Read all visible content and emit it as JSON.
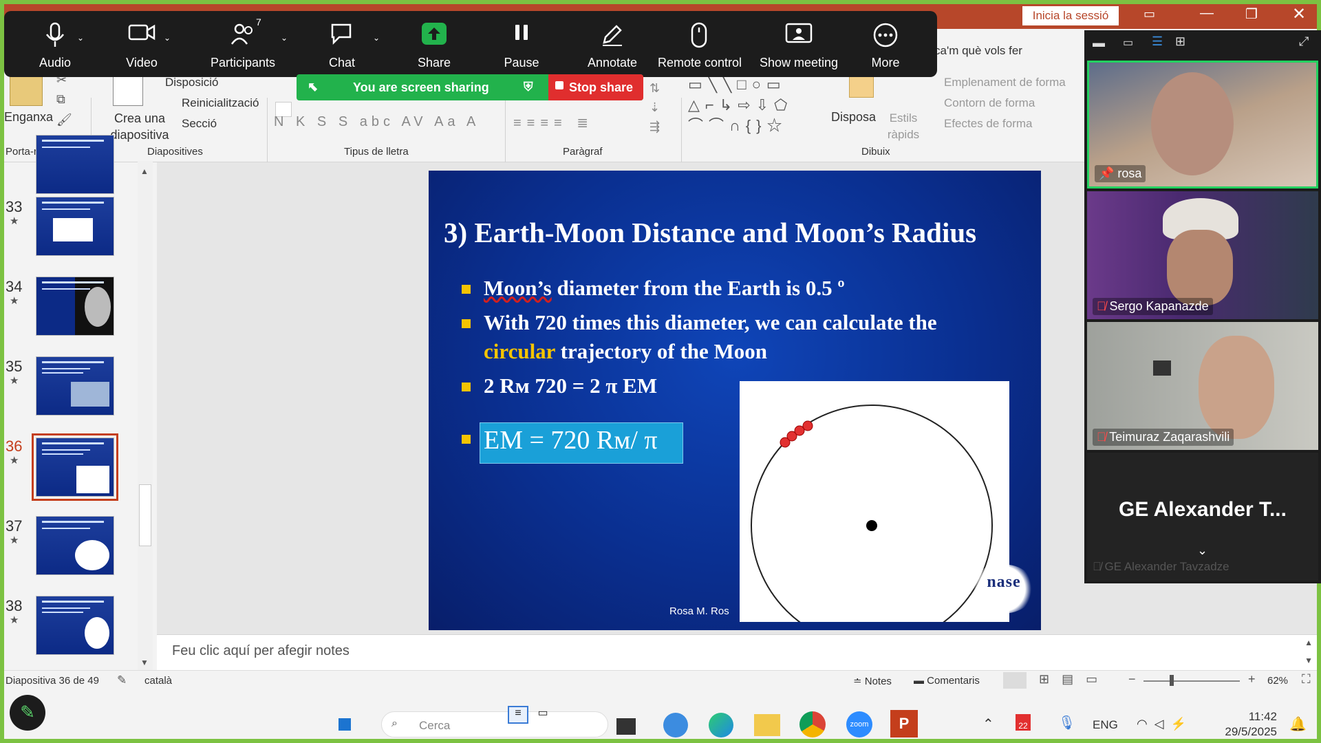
{
  "zoom": {
    "controls": [
      {
        "label": "Audio",
        "icon": "microphone-icon"
      },
      {
        "label": "Video",
        "icon": "video-camera-icon"
      },
      {
        "label": "Participants",
        "icon": "participants-icon",
        "badge": "7"
      },
      {
        "label": "Chat",
        "icon": "chat-icon"
      },
      {
        "label": "Share",
        "icon": "share-screen-icon"
      },
      {
        "label": "Pause",
        "icon": "pause-icon"
      },
      {
        "label": "Annotate",
        "icon": "pencil-icon"
      },
      {
        "label": "Remote control",
        "icon": "mouse-icon"
      },
      {
        "label": "Show meeting",
        "icon": "image-icon"
      },
      {
        "label": "More",
        "icon": "more-icon"
      }
    ],
    "sharing_label": "You are screen sharing",
    "stop_share_label": "Stop share",
    "participants": [
      {
        "name": "rosa",
        "pinned": true
      },
      {
        "name": "Sergo Kapanazde",
        "muted": true
      },
      {
        "name": "Teimuraz Zaqarashvili",
        "muted": true
      },
      {
        "name": "GE Alexander T...",
        "subname": "GE Alexander Tavzadze",
        "muted": true
      }
    ],
    "accent_green": "#22b24c",
    "stop_red": "#e02e2e"
  },
  "titlebar": {
    "signin_label": "Inicia la sessió",
    "tell_me": "ca'm què vols fer"
  },
  "ribbon": {
    "paste_label": "Enganxa",
    "new_slide_label": "Crea una diapositiva",
    "layout_label": "Disposició",
    "reset_label": "Reinicialització",
    "section_label": "Secció",
    "arrange_label": "Disposa",
    "quick_styles_label": "Estils ràpids",
    "shape_fill_label": "Emplenament de forma",
    "shape_outline_label": "Contorn de forma",
    "shape_effects_label": "Efectes de forma",
    "groups": {
      "clipboard": "Porta-retalls",
      "slides": "Diapositives",
      "font": "Tipus de lletra",
      "paragraph": "Paràgraf",
      "drawing": "Dibuix"
    },
    "font_buttons": [
      "N",
      "K",
      "S",
      "S",
      "abc",
      "AV",
      "Aa",
      "A"
    ]
  },
  "thumbnails": [
    {
      "num": "33"
    },
    {
      "num": "34"
    },
    {
      "num": "35"
    },
    {
      "num": "36",
      "selected": true
    },
    {
      "num": "37"
    },
    {
      "num": "38"
    }
  ],
  "slide": {
    "title": "3) Earth-Moon Distance and Moon’s Radius",
    "bullet1_a": "Moon’s",
    "bullet1_b": " diameter from the Earth is 0.5 º",
    "bullet2_line1": "With 720 times this diameter, we can calculate the",
    "bullet2_hl": "circular",
    "bullet2_rest": " trajectory of the Moon",
    "bullet3": "2 Rм 720 = 2 π EM",
    "equation": "EM = 720 Rм/ π",
    "credit": "Rosa M. Ros",
    "logo_text": "nase"
  },
  "notes_placeholder": "Feu clic aquí per afegir notes",
  "status": {
    "slide_counter": "Diapositiva 36 de 49",
    "language": "català",
    "notes_label": "Notes",
    "comments_label": "Comentaris",
    "zoom_level": "62%"
  },
  "taskbar": {
    "search_placeholder": "Cerca",
    "language": "ENG",
    "time": "11:42",
    "date": "29/5/2025",
    "badge_count": "22"
  }
}
